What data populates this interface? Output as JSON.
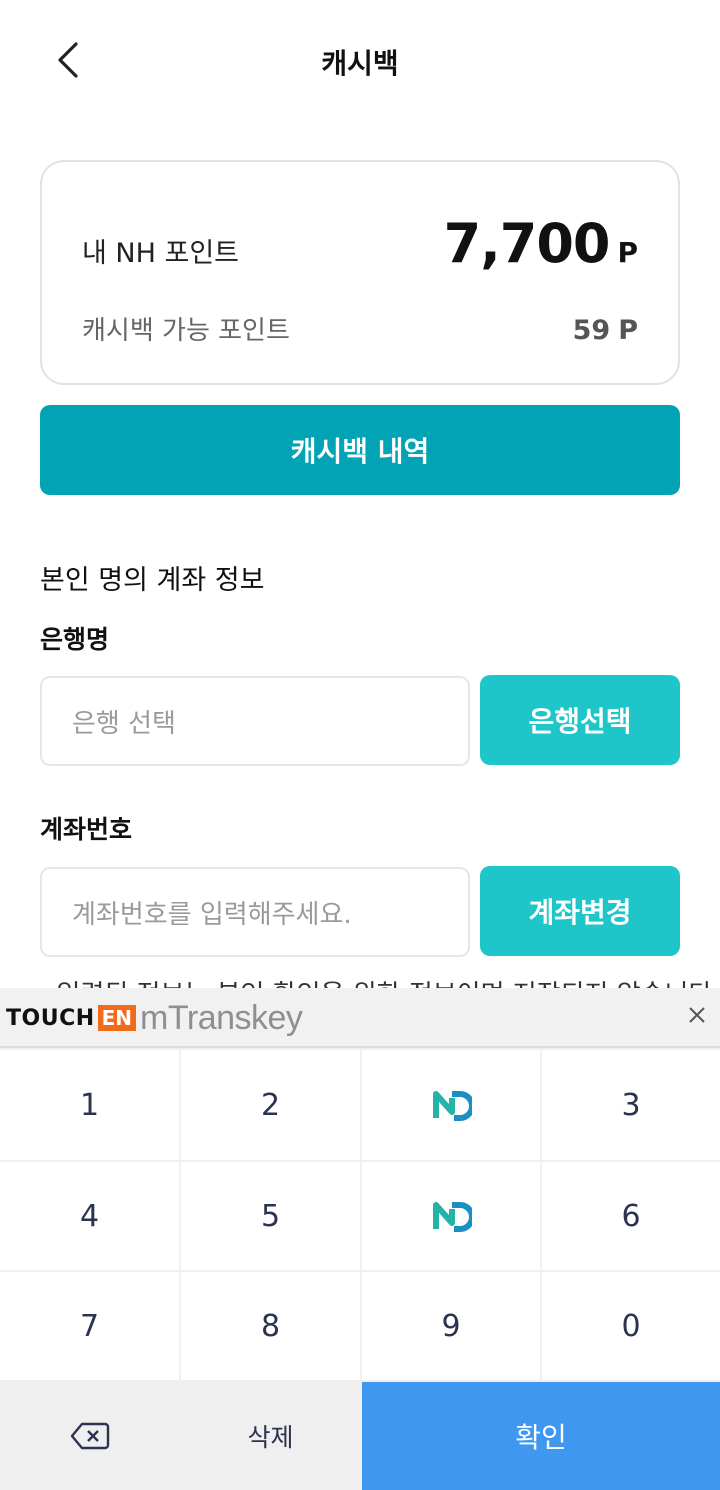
{
  "header": {
    "title": "캐시백",
    "back_icon": "chevron-left-icon"
  },
  "points_card": {
    "nh_points_label": "내 NH 포인트",
    "nh_points_value": "7,700",
    "nh_points_unit": "P",
    "cashback_label": "캐시백 가능 포인트",
    "cashback_value": "59",
    "cashback_unit": "P"
  },
  "history_button": {
    "label": "캐시백 내역",
    "color": "#02a3b5"
  },
  "account_section": {
    "title": "본인 명의 계좌 정보",
    "bank": {
      "label": "은행명",
      "placeholder": "은행 선택",
      "button": "은행선택"
    },
    "account": {
      "label": "계좌번호",
      "placeholder": "계좌번호를 입력해주세요.",
      "button": "계좌변경"
    },
    "button_color": "#1fc6c9"
  },
  "notice": {
    "text": "· 입력된 정보는 본인 확인을 위한 정보이며 저장되지 않습니다."
  },
  "keypad": {
    "brand_touch": "TOUCH",
    "brand_en": "EN",
    "brand_name": "mTranskey",
    "close_icon": "close-icon",
    "rows": [
      [
        "1",
        "2",
        "N",
        "3"
      ],
      [
        "4",
        "5",
        "N",
        "6"
      ],
      [
        "7",
        "8",
        "9",
        "0"
      ]
    ],
    "delete_icon": "backspace-icon",
    "clear_label": "삭제",
    "confirm_label": "확인",
    "confirm_color": "#3f97f0"
  }
}
